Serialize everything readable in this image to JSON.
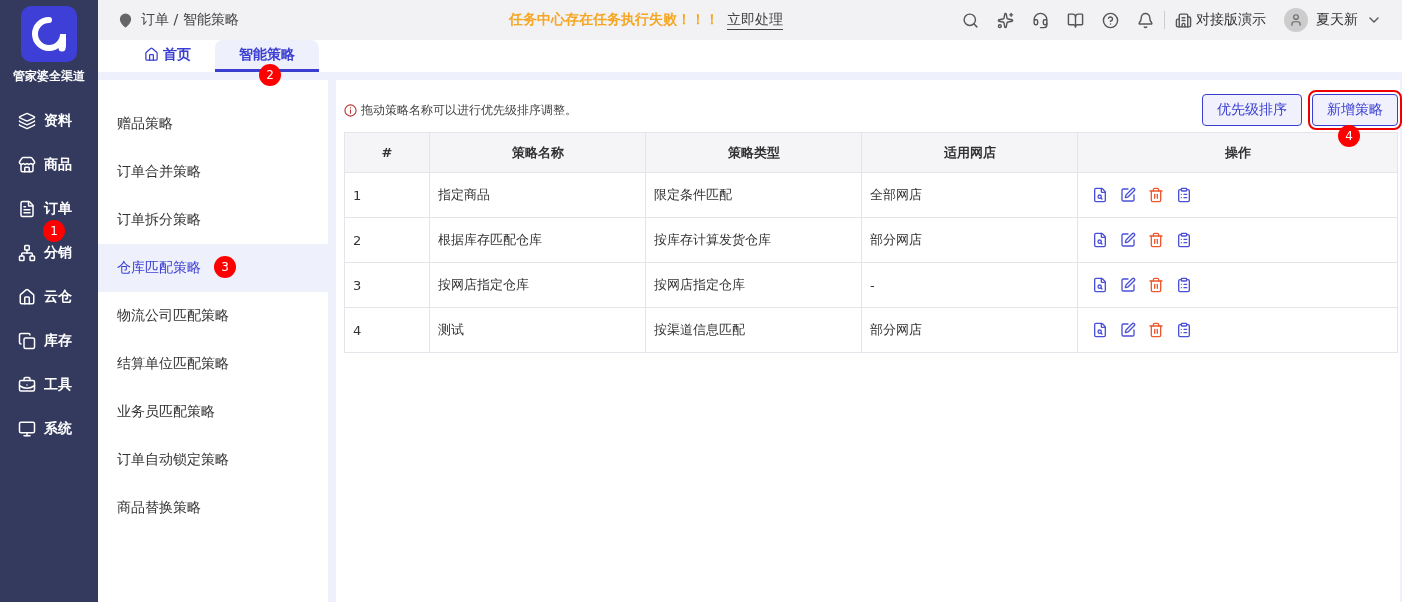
{
  "app": {
    "name": "管家婆全渠道"
  },
  "nav": [
    {
      "label": "资料",
      "selected": false
    },
    {
      "label": "商品",
      "selected": false
    },
    {
      "label": "订单",
      "selected": false,
      "marker": "1"
    },
    {
      "label": "分销",
      "selected": false
    },
    {
      "label": "云仓",
      "selected": false
    },
    {
      "label": "库存",
      "selected": false
    },
    {
      "label": "工具",
      "selected": false
    },
    {
      "label": "系统",
      "selected": false
    }
  ],
  "breadcrumb": "订单 / 智能策略",
  "alert": {
    "message": "任务中心存在任务执行失败！！！",
    "action": "立即处理"
  },
  "topbar": {
    "company": "对接版演示",
    "user": "夏天新"
  },
  "tabs": [
    {
      "label": "首页",
      "selected": false
    },
    {
      "label": "智能策略",
      "selected": true,
      "marker": "2"
    }
  ],
  "menu": [
    {
      "label": "赠品策略",
      "selected": false
    },
    {
      "label": "订单合并策略",
      "selected": false
    },
    {
      "label": "订单拆分策略",
      "selected": false
    },
    {
      "label": "仓库匹配策略",
      "selected": true,
      "marker": "3"
    },
    {
      "label": "物流公司匹配策略",
      "selected": false
    },
    {
      "label": "结算单位匹配策略",
      "selected": false
    },
    {
      "label": "业务员匹配策略",
      "selected": false
    },
    {
      "label": "订单自动锁定策略",
      "selected": false
    },
    {
      "label": "商品替换策略",
      "selected": false
    }
  ],
  "hint": "拖动策略名称可以进行优先级排序调整。",
  "buttons": [
    {
      "label": "优先级排序",
      "highlighted": false
    },
    {
      "label": "新增策略",
      "highlighted": true,
      "marker": "4"
    }
  ],
  "table": {
    "columns": [
      "#",
      "策略名称",
      "策略类型",
      "适用网店",
      "操作"
    ],
    "rows": [
      [
        "1",
        "指定商品",
        "限定条件匹配",
        "全部网店"
      ],
      [
        "2",
        "根据库存匹配仓库",
        "按库存计算发货仓库",
        "部分网店"
      ],
      [
        "3",
        "按网店指定仓库",
        "按网店指定仓库",
        "-"
      ],
      [
        "4",
        "测试",
        "按渠道信息匹配",
        "部分网店"
      ]
    ]
  }
}
